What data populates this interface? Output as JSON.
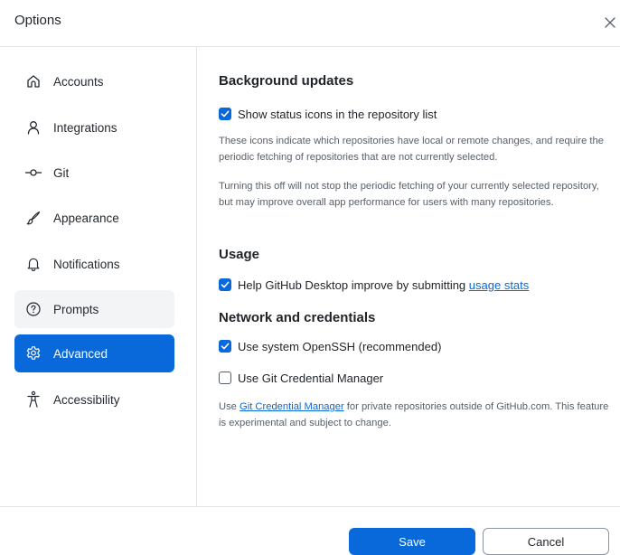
{
  "dialog": {
    "title": "Options",
    "close_icon": "close-icon"
  },
  "sidebar": {
    "items": [
      {
        "label": "Accounts",
        "icon": "home-icon"
      },
      {
        "label": "Integrations",
        "icon": "person-icon"
      },
      {
        "label": "Git",
        "icon": "git-commit-icon"
      },
      {
        "label": "Appearance",
        "icon": "paintbrush-icon"
      },
      {
        "label": "Notifications",
        "icon": "bell-icon"
      },
      {
        "label": "Prompts",
        "icon": "question-icon"
      },
      {
        "label": "Advanced",
        "icon": "gear-icon"
      },
      {
        "label": "Accessibility",
        "icon": "accessibility-icon"
      }
    ],
    "active": "Advanced",
    "hovered": "Prompts"
  },
  "background_updates": {
    "heading": "Background updates",
    "show_status_icons": {
      "label": "Show status icons in the repository list",
      "checked": true
    },
    "desc1": "These icons indicate which repositories have local or remote changes, and require the periodic fetching of repositories that are not currently selected.",
    "desc2": "Turning this off will not stop the periodic fetching of your currently selected repository, but may improve overall app performance for users with many repositories."
  },
  "usage": {
    "heading": "Usage",
    "help_improve": {
      "label_prefix": "Help GitHub Desktop improve by submitting ",
      "link": "usage stats",
      "checked": true
    }
  },
  "network": {
    "heading": "Network and credentials",
    "openssh": {
      "label": "Use system OpenSSH (recommended)",
      "checked": true
    },
    "gcm": {
      "label": "Use Git Credential Manager",
      "checked": false
    },
    "desc_prefix": "Use ",
    "desc_link": "Git Credential Manager",
    "desc_suffix": " for private repositories outside of GitHub.com. This feature is experimental and subject to change."
  },
  "footer": {
    "save_label": "Save",
    "cancel_label": "Cancel"
  },
  "colors": {
    "accent": "#0969da",
    "text": "#1f2328",
    "muted": "#57606a",
    "hover_bg": "#f3f4f6"
  }
}
